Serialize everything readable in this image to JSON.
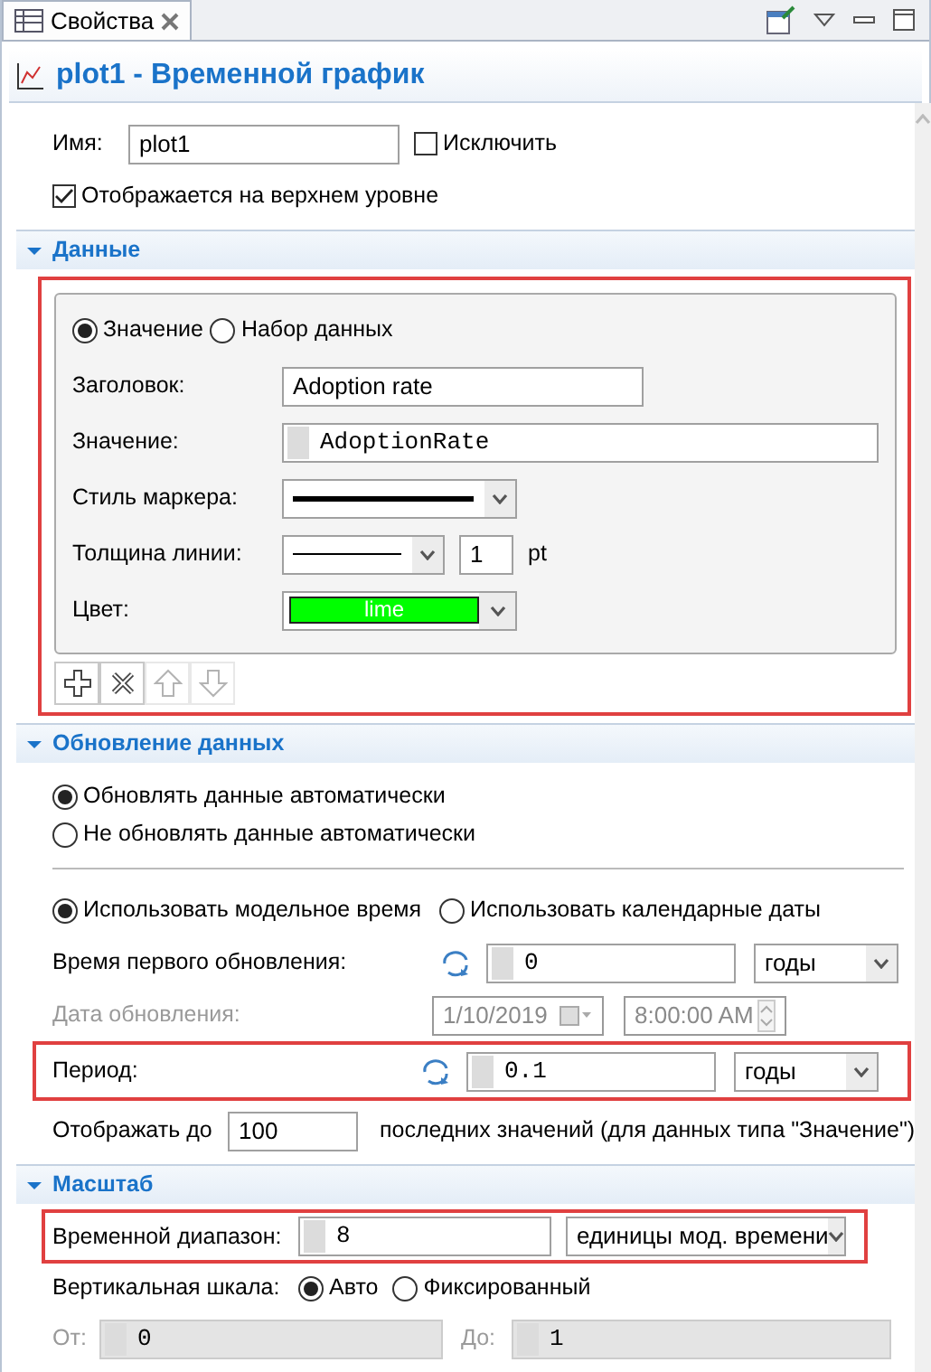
{
  "tab": {
    "title": "Свойства"
  },
  "header": {
    "title": "plot1 - Временной график"
  },
  "name_row": {
    "label": "Имя:",
    "value": "plot1",
    "exclude": {
      "label": "Исключить",
      "checked": false
    }
  },
  "top_level": {
    "label": "Отображается на верхнем уровне",
    "checked": true
  },
  "data_section": {
    "title": "Данные",
    "expanded": true,
    "highlighted": true,
    "source": [
      {
        "label": "Значение",
        "selected": true
      },
      {
        "label": "Набор данных",
        "selected": false
      }
    ],
    "title_field": {
      "label": "Заголовок:",
      "value": "Adoption rate"
    },
    "value_field": {
      "label": "Значение:",
      "value": "AdoptionRate"
    },
    "marker_style": {
      "label": "Стиль маркера:"
    },
    "line_width": {
      "label": "Толщина линии:",
      "value": "1",
      "unit": "pt"
    },
    "line_color": {
      "label": "Цвет:",
      "value": "lime",
      "color": "#00ff00"
    },
    "tools": [
      {
        "kind": "add",
        "disabled": false
      },
      {
        "kind": "remove",
        "disabled": false
      },
      {
        "kind": "up",
        "disabled": true
      },
      {
        "kind": "down",
        "disabled": true
      }
    ]
  },
  "update_section": {
    "title": "Обновление данных",
    "expanded": true,
    "mode": [
      {
        "label": "Обновлять данные автоматически",
        "selected": true
      },
      {
        "label": "Не обновлять данные автоматически",
        "selected": false
      }
    ],
    "time_mode": [
      {
        "label": "Использовать модельное время",
        "selected": true
      },
      {
        "label": "Использовать календарные даты",
        "selected": false
      }
    ],
    "first_update": {
      "label": "Время первого обновления:",
      "value": "0",
      "unit": "годы"
    },
    "update_date": {
      "label": "Дата обновления:",
      "date": "1/10/2019",
      "time": "8:00:00 AM",
      "disabled": true
    },
    "period": {
      "label": "Период:",
      "value": "0.1",
      "unit": "годы",
      "highlighted": true
    },
    "display": {
      "label": "Отображать до",
      "value": "100",
      "suffix": "последних значений (для данных типа \"Значение\")"
    }
  },
  "scale_section": {
    "title": "Масштаб",
    "expanded": true,
    "time_range": {
      "label": "Временной диапазон:",
      "value": "8",
      "unit": "единицы мод. времени",
      "highlighted": true
    },
    "vertical": {
      "label": "Вертикальная шкала:",
      "options": [
        {
          "label": "Авто",
          "selected": true
        },
        {
          "label": "Фиксированный",
          "selected": false
        }
      ]
    },
    "from": {
      "label": "От:",
      "value": "0",
      "disabled": true
    },
    "to": {
      "label": "До:",
      "value": "1",
      "disabled": true
    }
  }
}
